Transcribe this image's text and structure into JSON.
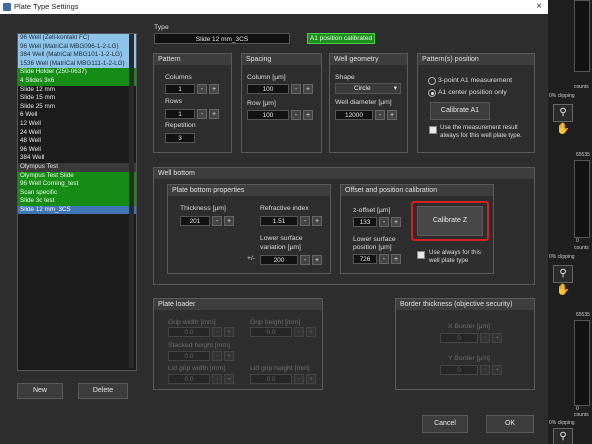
{
  "window": {
    "title": "Plate Type Settings",
    "close_icon": "×"
  },
  "list": {
    "items": [
      {
        "label": "96 Well (Zell-kontakt FC)",
        "style": "blue"
      },
      {
        "label": "96 Well (MatriCal MBG096-1-2-LG)",
        "style": "blue"
      },
      {
        "label": "384 Well (MatriCal MBG101-1-2-LG)",
        "style": "blue"
      },
      {
        "label": "1536 Well (MatriCal MBG111-1-2-LG)",
        "style": "blue"
      },
      {
        "label": "Slide Holder (250-0637)",
        "style": "green"
      },
      {
        "label": "4 Slides 3x6",
        "style": "green"
      },
      {
        "label": "Slide 12 mm",
        "style": "dark"
      },
      {
        "label": "Slide 15 mm",
        "style": "dark"
      },
      {
        "label": "Slide 25 mm",
        "style": "dark"
      },
      {
        "label": "6   Well",
        "style": "dark"
      },
      {
        "label": "12  Well",
        "style": "dark"
      },
      {
        "label": "24  Well",
        "style": "dark"
      },
      {
        "label": "48  Well",
        "style": "dark"
      },
      {
        "label": "96  Well",
        "style": "dark"
      },
      {
        "label": "384 Well",
        "style": "dark"
      },
      {
        "label": "Olympus Test",
        "style": "gray"
      },
      {
        "label": "Olympus Test Slide",
        "style": "green"
      },
      {
        "label": "96  Well Corning_test",
        "style": "green"
      },
      {
        "label": "Scan specific",
        "style": "green"
      },
      {
        "label": "Slide 3c test",
        "style": "green"
      },
      {
        "label": "Slide 12 mm_3CS",
        "style": "sel"
      }
    ],
    "new_label": "New",
    "delete_label": "Delete"
  },
  "type": {
    "label": "Type",
    "name_value": "Slide 12 mm_3CS",
    "calibrated_badge": "A1 position calibrated",
    "badge_color": "#1a8f1a"
  },
  "pattern": {
    "title": "Pattern",
    "columns_label": "Columns",
    "columns_value": "1",
    "rows_label": "Rows",
    "rows_value": "1",
    "repetition_label": "Repetition",
    "repetition_value": "3"
  },
  "spacing": {
    "title": "Spacing",
    "column_label": "Column [µm]",
    "column_value": "100",
    "row_label": "Row [µm]",
    "row_value": "100"
  },
  "well_geometry": {
    "title": "Well geometry",
    "shape_label": "Shape",
    "shape_value": "Circle",
    "diameter_label": "Well diameter [µm]",
    "diameter_value": "12000"
  },
  "patterns_panel": {
    "title": "Pattern(s) position",
    "option1": "3-point A1 measurement",
    "option2": "A1 center position only",
    "calibrate_a1": "Calibrate A1",
    "use_measurement_line1": "Use the measurement result",
    "use_measurement_line2": "always for this well plate type."
  },
  "well_bottom": {
    "title": "Well bottom",
    "plate_bottom_title": "Plate bottom properties",
    "thickness_label": "Thickness [µm]",
    "thickness_value": "201",
    "refractive_label": "Refractive index",
    "refractive_value": "1.51",
    "lower_var_label1": "Lower surface",
    "lower_var_label2": "variation [µm]",
    "plusminus": "+/-",
    "lower_var_value": "200",
    "offset_title": "Offset and position calibration",
    "zoffset_label": "z-offset [µm]",
    "zoffset_value": "133",
    "lower_pos_label1": "Lower surface",
    "lower_pos_label2": "position [µm]",
    "lower_pos_value": "726",
    "calibrate_z": "Calibrate Z",
    "use_always_line1": "Use always for this",
    "use_always_line2": "well plate type",
    "highlight_color": "#d42020"
  },
  "plate_loader": {
    "title": "Plate loader",
    "grip_width_label": "Grip width [mm]",
    "grip_width_value": "0.0",
    "grip_height_label": "Grip height [mm]",
    "grip_height_value": "0.0",
    "stacked_label": "Stacked height [mm]",
    "stacked_value": "0.0",
    "lid_width_label": "Lid grip width [mm]",
    "lid_width_value": "0.0",
    "lid_height_label": "Lid grip height [mm]",
    "lid_height_value": "0.0"
  },
  "border": {
    "title": "Border thickness (objective security)",
    "x_label": "X Border [µm]",
    "x_value": "0",
    "y_label": "Y Border [µm]",
    "y_value": "0"
  },
  "footer": {
    "cancel_label": "Cancel",
    "ok_label": "OK"
  },
  "side": {
    "v1": "65535",
    "counts": "counts",
    "clip": "0% clipping",
    "v0": "0",
    "v2": "65535",
    "v3": "65535",
    "zoom_icon": "magnifier-icon",
    "hand_icon": "hand-icon"
  },
  "spin_minus": "-",
  "spin_plus": "+",
  "dropdown_arrow": "▾"
}
